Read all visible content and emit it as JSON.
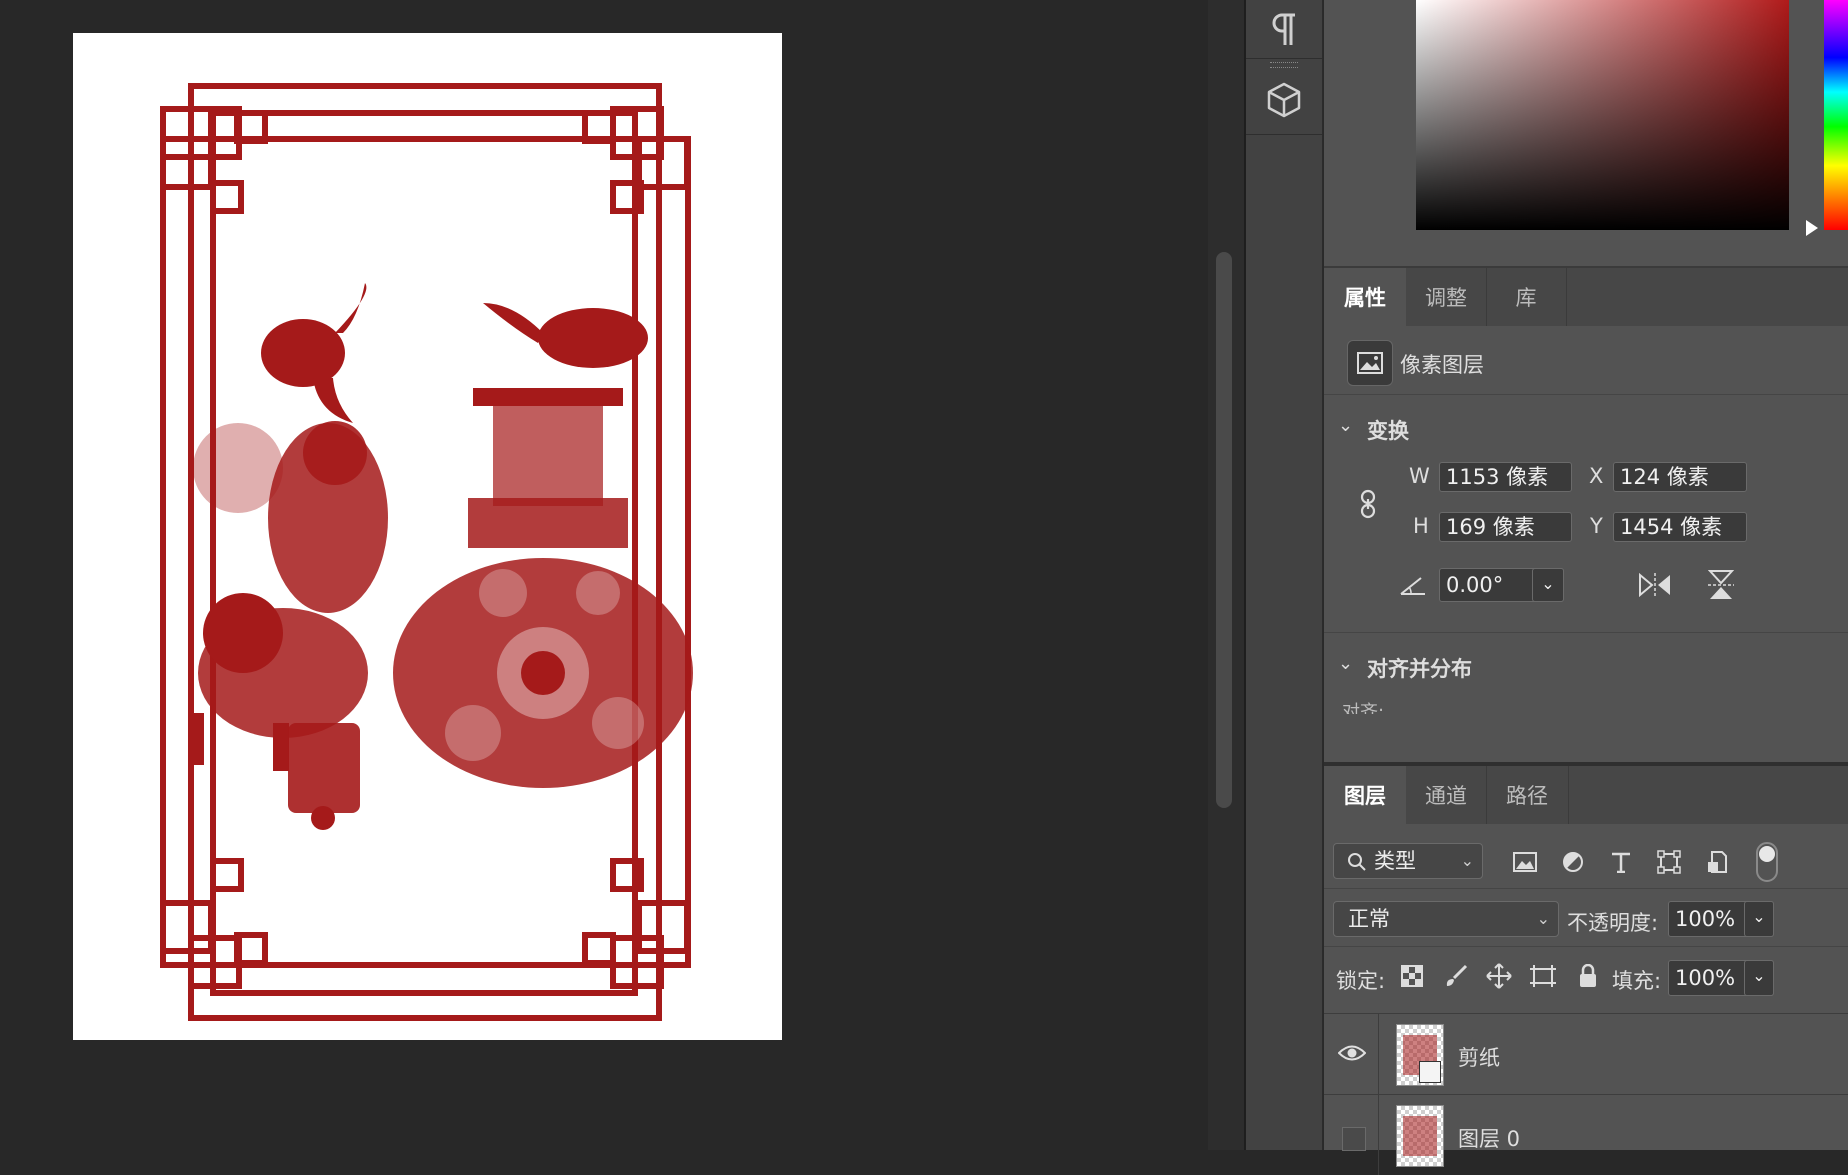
{
  "colors": {
    "canvas_bg": "#282828",
    "panel_bg": "#535353",
    "papercut_red": "#a51a1a"
  },
  "toolstrip": {
    "items": [
      "paragraph-icon",
      "3d-cube-icon"
    ]
  },
  "properties_panel": {
    "tabs": [
      "属性",
      "调整",
      "库"
    ],
    "active_tab": "属性",
    "layer_type": "像素图层",
    "transform": {
      "section_title": "变换",
      "w_label": "W",
      "w_value": "1153 像素",
      "x_label": "X",
      "x_value": "124 像素",
      "h_label": "H",
      "h_value": "169 像素",
      "y_label": "Y",
      "y_value": "1454 像素",
      "angle_value": "0.00°"
    },
    "align": {
      "section_title": "对齐并分布",
      "cut_label": "对齐:"
    }
  },
  "layers_panel": {
    "tabs": [
      "图层",
      "通道",
      "路径"
    ],
    "active_tab": "图层",
    "filter_label": "类型",
    "blend_mode": "正常",
    "opacity_label": "不透明度:",
    "opacity_value": "100%",
    "lock_label": "锁定:",
    "fill_label": "填充:",
    "fill_value": "100%",
    "layers": [
      {
        "name": "剪纸",
        "visible": true
      },
      {
        "name": "图层 0",
        "visible": false
      }
    ]
  }
}
